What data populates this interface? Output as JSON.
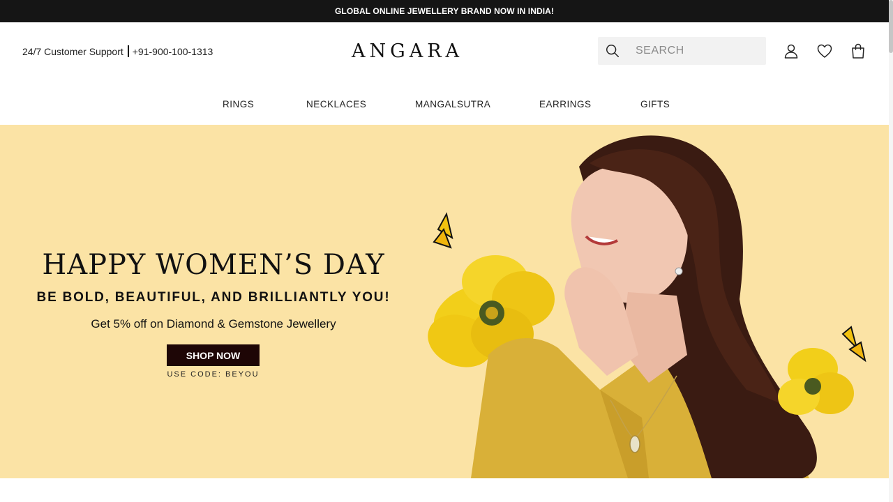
{
  "announcement": "GLOBAL ONLINE JEWELLERY BRAND NOW IN INDIA!",
  "header": {
    "support_label": "24/7 Customer Support",
    "phone": "+91-900-100-1313",
    "logo": "ANGARA",
    "search_placeholder": "SEARCH",
    "icons": [
      "search-icon",
      "user-icon",
      "heart-icon",
      "bag-icon"
    ]
  },
  "nav": {
    "items": [
      {
        "label": "RINGS"
      },
      {
        "label": "NECKLACES"
      },
      {
        "label": "MANGALSUTRA"
      },
      {
        "label": "EARRINGS"
      },
      {
        "label": "GIFTS"
      }
    ]
  },
  "hero": {
    "title": "HAPPY WOMEN’S DAY",
    "subtitle": "BE BOLD, BEAUTIFUL, AND BRILLIANTLY YOU!",
    "offer": "Get 5% off on Diamond & Gemstone Jewellery",
    "cta": "SHOP NOW",
    "code": "USE CODE: BEYOU"
  },
  "colors": {
    "topbar": "#151515",
    "hero_bg": "#fbe3a5",
    "cta_bg": "#1e0606",
    "flower": "#f2cf1a",
    "dress": "#d9b038",
    "hair": "#3a1b12"
  }
}
